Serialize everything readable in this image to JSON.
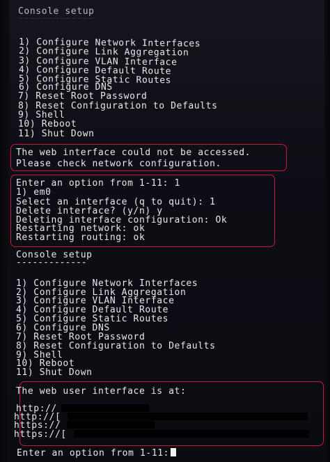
{
  "screen1": {
    "title": "Console setup",
    "underline": "=============",
    "menu": [
      "1) Configure Network Interfaces",
      "2) Configure Link Aggregation",
      "3) Configure VLAN Interface",
      "4) Configure Default Route",
      "5) Configure Static Routes",
      "6) Configure DNS",
      "7) Reset Root Password",
      "8) Reset Configuration to Defaults",
      "9) Shell",
      "10) Reboot",
      "11) Shut Down"
    ]
  },
  "error": {
    "line1": "The web interface could not be accessed.",
    "line2": "Please check network configuration."
  },
  "session": [
    "Enter an option from 1-11: 1",
    "1) em0",
    "Select an interface (q to quit): 1",
    "Delete interface? (y/n) y",
    "Deleting interface configuration: Ok",
    "Restarting network: ok",
    "Restarting routing: ok"
  ],
  "screen2": {
    "title": "Console setup",
    "underline": "-------------",
    "menu": [
      "1) Configure Network Interfaces",
      "2) Configure Link Aggregation",
      "3) Configure VLAN Interface",
      "4) Configure Default Route",
      "5) Configure Static Routes",
      "6) Configure DNS",
      "7) Reset Root Password",
      "8) Reset Configuration to Defaults",
      "9) Shell",
      "10) Reboot",
      "11) Shut Down"
    ]
  },
  "web_ui": {
    "header": "The web user interface is at:",
    "urls": [
      "http://",
      "http://[",
      "https://",
      "https://["
    ]
  },
  "prompt": "Enter an option from 1-11:",
  "colors": {
    "text": "#e8e8ef",
    "highlight_box": "#d0143a",
    "background": "#0b0c12"
  }
}
